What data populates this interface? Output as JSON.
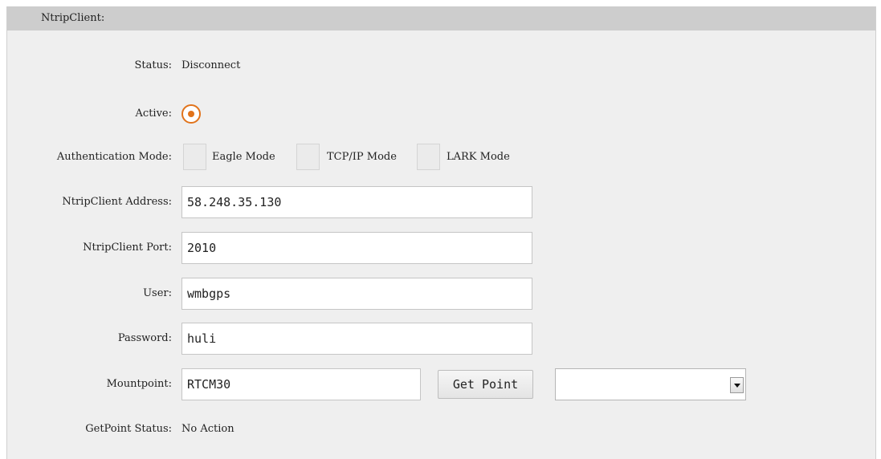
{
  "header": {
    "title": "NtripClient:"
  },
  "status": {
    "label": "Status:",
    "value": "Disconnect"
  },
  "active": {
    "label": "Active:",
    "checked": true
  },
  "auth": {
    "label": "Authentication Mode:",
    "options": [
      "Eagle Mode",
      "TCP/IP Mode",
      "LARK Mode"
    ]
  },
  "address": {
    "label": "NtripClient Address:",
    "value": "58.248.35.130"
  },
  "port": {
    "label": "NtripClient Port:",
    "value": "2010"
  },
  "user": {
    "label": "User:",
    "value": "wmbgps"
  },
  "password": {
    "label": "Password:",
    "value": "huli"
  },
  "mountpoint": {
    "label": "Mountpoint:",
    "value": "RTCM30",
    "button": "Get Point",
    "select_value": ""
  },
  "getpoint_status": {
    "label": "GetPoint Status:",
    "value": "No Action"
  },
  "colors": {
    "accent": "#e1731b",
    "panel": "#efefef",
    "header": "#cdcdcd"
  }
}
